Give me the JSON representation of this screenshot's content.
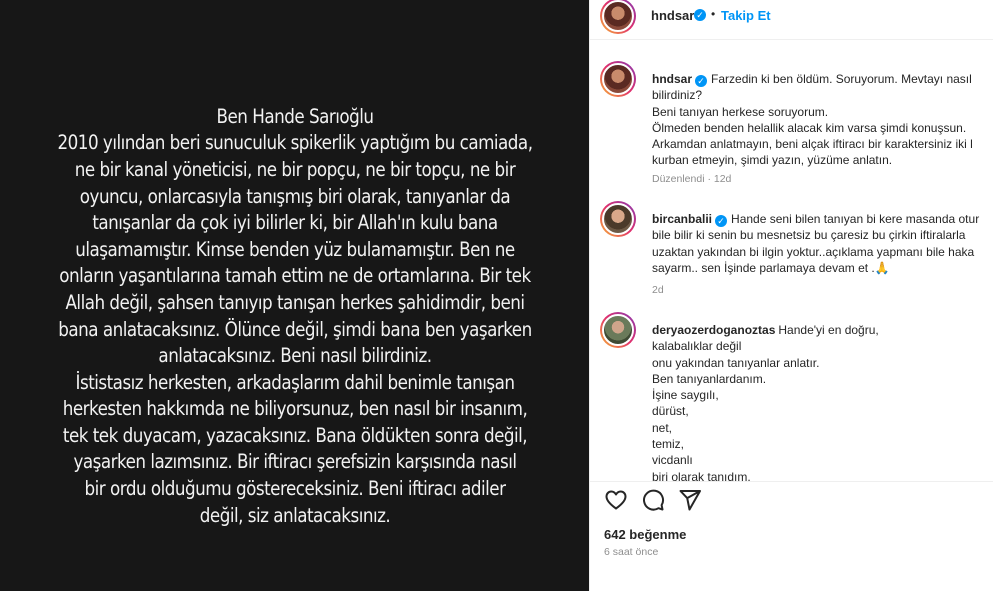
{
  "post": {
    "text": "Ben Hande Sarıoğlu\n2010 yılından beri sunuculuk spikerlik yaptığım bu camiada,\nne bir kanal yöneticisi, ne bir popçu, ne bir topçu, ne bir\noyuncu, onlarcasıyla tanışmış biri olarak, tanıyanlar da\ntanışanlar da çok iyi bilirler ki, bir Allah'ın kulu bana\nulaşamamıştır. Kimse benden yüz bulamamıştır. Ben ne\nonların yaşantılarına tamah ettim ne de ortamlarına. Bir tek\nAllah değil, şahsen tanıyıp tanışan herkes şahidimdir, beni\nbana anlatacaksınız. Ölünce değil, şimdi bana ben yaşarken\nanlatacaksınız. Beni nasıl bilirdiniz.\nİstistasız herkesten, arkadaşlarım dahil benimle tanışan\nherkesten hakkımda ne biliyorsunuz, ben nasıl bir insanım,\ntek tek duyacam, yazacaksınız. Bana öldükten sonra değil,\nyaşarken lazımsınız. Bir iftiracı şerefsizin karşısında nasıl\nbir ordu olduğumu göstereceksiniz. Beni iftiracı adiler\ndeğil, siz anlatacaksınız."
  },
  "header": {
    "username": "hndsar",
    "dot": "•",
    "follow_label": "Takip Et"
  },
  "comments": [
    {
      "username": "hndsar",
      "lines": [
        "Farzedin ki ben öldüm. Soruyorum. Mevtayı nasıl",
        "bilirdiniz?",
        "Beni tanıyan herkese soruyorum.",
        "Ölmeden benden helallik alacak kim varsa şimdi konuşsun.",
        "Arkamdan anlatmayın, beni alçak iftiracı bir karaktersiniz iki l",
        "kurban etmeyin, şimdi yazın, yüzüme anlatın."
      ],
      "meta": "Düzenlendi · 12d"
    },
    {
      "username": "bircanbalii",
      "lines": [
        "Hande seni bilen tanıyan bi kere masanda otur",
        "bile bilir ki senin bu mesnetsiz bu çaresiz bu çirkin iftiralarla",
        "uzaktan yakından bi ilgin yoktur..açıklama yapmanı bile haka",
        "sayarm.. sen İşinde parlamaya devam et .🙏"
      ],
      "meta": "2d"
    },
    {
      "username": "deryaozerdoganoztas",
      "lines": [
        "Hande'yi en doğru,",
        "kalabalıklar değil",
        "onu yakından tanıyanlar anlatır.",
        "Ben tanıyanlardanım.",
        "İşine saygılı,",
        "dürüst,",
        "net,",
        "temiz,",
        "vicdanlı",
        "biri olarak tanıdım."
      ],
      "meta": ""
    }
  ],
  "icons": {
    "like": "heart-icon",
    "comment": "comment-icon",
    "share": "send-icon",
    "verified": "verified-badge-icon"
  },
  "footer": {
    "likes": "642 beğenme",
    "time": "6 saat önce"
  },
  "colors": {
    "accent": "#0095f6",
    "post_background": "#171717",
    "muted": "#8e8e8e"
  }
}
